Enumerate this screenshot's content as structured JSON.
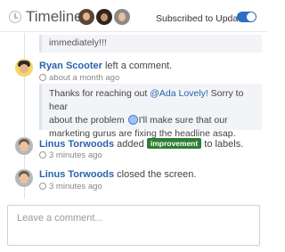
{
  "header": {
    "title": "Timeline",
    "subscribed_label": "Subscribed to Updates",
    "subscribed": true
  },
  "feed": {
    "snippet_text": "immediately!!!",
    "entries": [
      {
        "author": "Ryan Scooter",
        "action": " left a comment.",
        "time": "about a month ago",
        "comment": {
          "part1": "Thanks for reaching out ",
          "mention": "@Ada Lovely!",
          "part2": " Sorry to hear",
          "line2a": "about the problem ",
          "line2b": "I'll make sure that our",
          "line3": "marketing gurus are fixing the headline asap."
        }
      },
      {
        "author": "Linus Torwoods",
        "action": " added ",
        "label": "improvement",
        "action_tail": " to labels.",
        "time": "3 minutes ago"
      },
      {
        "author": "Linus Torwoods",
        "action": " closed the screen.",
        "time": "3 minutes ago"
      }
    ]
  },
  "composer": {
    "placeholder": "Leave a comment..."
  }
}
